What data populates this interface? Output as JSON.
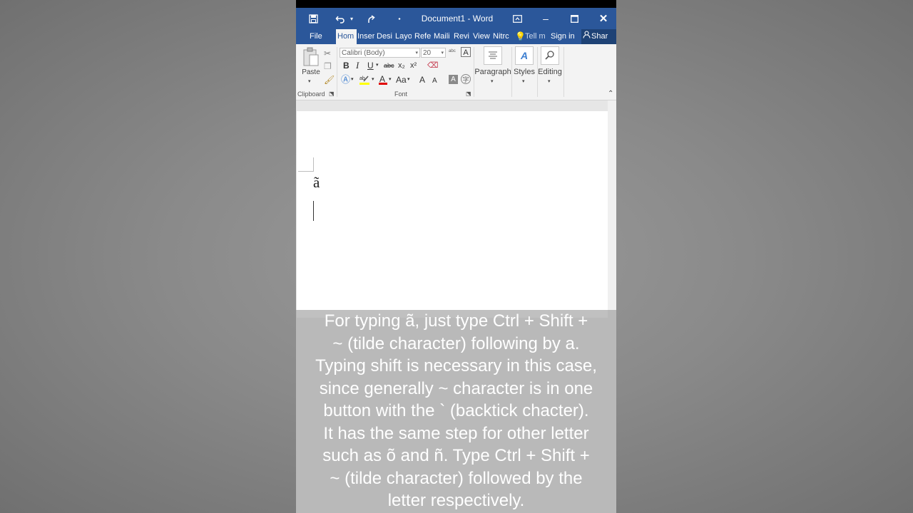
{
  "title_bar": {
    "doc_title": "Document1 - Word",
    "minimize": "–",
    "restore": "🗖",
    "close": "✕"
  },
  "tabs": [
    "File",
    "Hom",
    "Inser",
    "Desi",
    "Layo",
    "Refe",
    "Maili",
    "Revi",
    "View",
    "Nitrc"
  ],
  "tell_me": "Tell m",
  "sign_in": "Sign in",
  "share": "Shar",
  "ribbon": {
    "paste_label": "Paste",
    "font_name": "Calibri (Body)",
    "font_size": "20",
    "clipboard_label": "Clipboard",
    "font_label": "Font",
    "paragraph_label": "Paragraph",
    "styles_label": "Styles",
    "editing_label": "Editing",
    "bold": "B",
    "italic": "I",
    "underline": "U",
    "strike": "abc",
    "subscript": "x₂",
    "superscript": "x²",
    "case": "Aa",
    "grow": "A",
    "shrink": "A"
  },
  "document": {
    "text": "ã"
  },
  "caption_lines": [
    "For typing ã, just type Ctrl + Shift +",
    "~ (tilde character)  following by a.",
    "Typing shift is necessary in this case,",
    "since generally ~ character is in one",
    "button with the ` (backtick chacter).",
    "It has the same step for other letter",
    "such as õ and ñ. Type Ctrl + Shift +",
    "~ (tilde character) followed by the",
    "letter respectively."
  ],
  "colors": {
    "word_blue": "#2b579a",
    "ribbon_bg": "#f3f3f3"
  }
}
